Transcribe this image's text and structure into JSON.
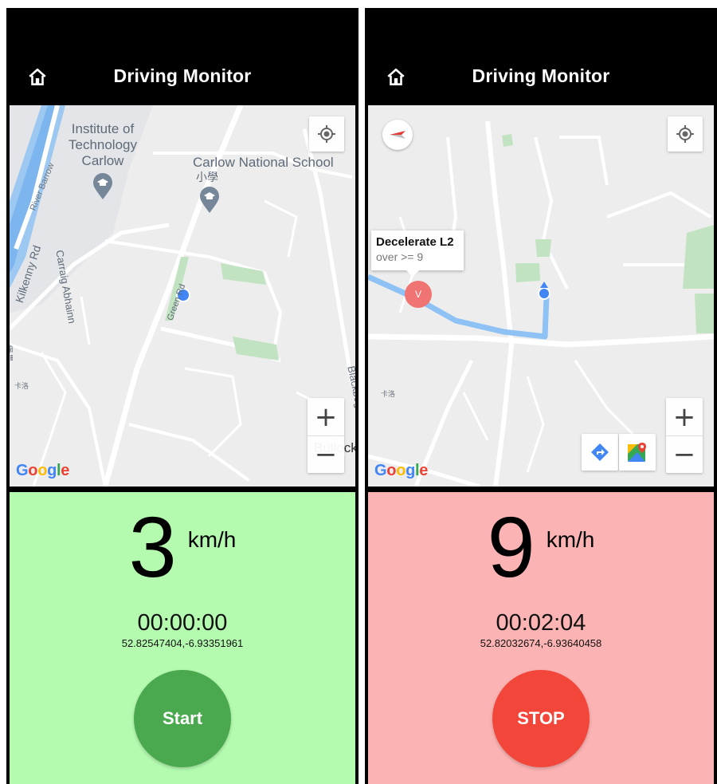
{
  "colors": {
    "appbar": "#000000",
    "green_panel": "#b4fbb0",
    "red_panel": "#fcb3b3",
    "start_button": "#4aa84e",
    "stop_button": "#f3463b",
    "location_dot": "#4285f4",
    "route": "#8ec2f5"
  },
  "left": {
    "appbar": {
      "title": "Driving Monitor",
      "home_icon": "home-icon"
    },
    "map": {
      "labels": {
        "institute": "Institute of\nTechnology\nCarlow",
        "school": "Carlow National School",
        "school_sub": "小學",
        "river": "River Barrow",
        "kilkenny": "Kilkenny Rd",
        "carraig": "Carraig Abhainn",
        "green_rd": "Green Rd",
        "blackbog": "Blackbog Rd",
        "bullock": "Bullock",
        "small_cjk": "堡壘",
        "small_cjk2": "卡洛"
      },
      "attribution": "Google"
    },
    "panel": {
      "speed": "3",
      "unit": "km/h",
      "timer": "00:00:00",
      "coords": "52.82547404,-6.93351961",
      "button_label": "Start"
    }
  },
  "right": {
    "appbar": {
      "title": "Driving Monitor",
      "home_icon": "home-icon"
    },
    "map": {
      "info_window": {
        "title": "Decelerate L2",
        "snippet": "over >= 9"
      },
      "marker_label": "V",
      "small_cjk": "卡洛",
      "attribution": "Google"
    },
    "panel": {
      "speed": "9",
      "unit": "km/h",
      "timer": "00:02:04",
      "coords": "52.82032674,-6.93640458",
      "button_label": "STOP"
    }
  }
}
